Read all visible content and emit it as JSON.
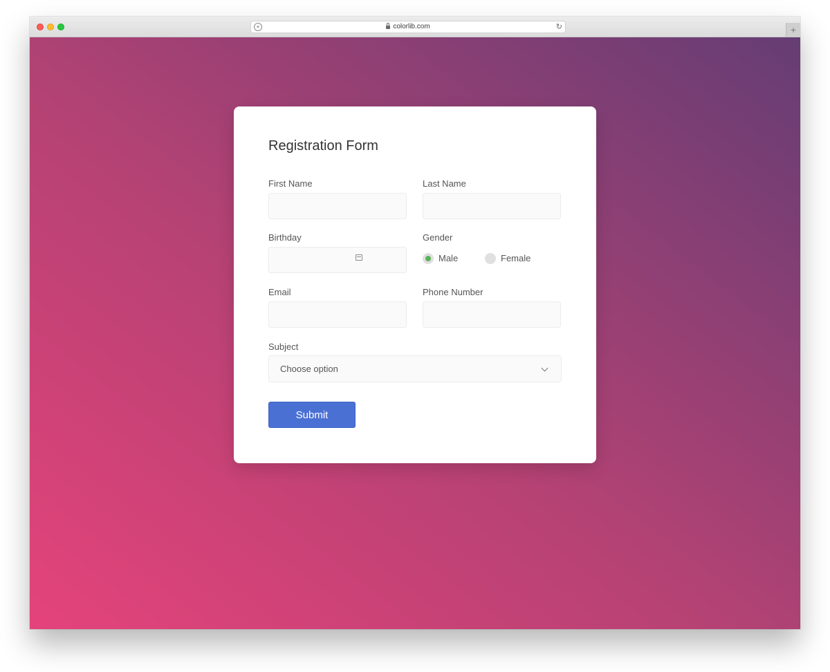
{
  "browser": {
    "url": "colorlib.com",
    "icons": {
      "add": "plus-circle-icon",
      "secure": "lock-icon",
      "reload": "reload-icon",
      "new_tab": "plus-icon"
    }
  },
  "form": {
    "title": "Registration Form",
    "first_name": {
      "label": "First Name",
      "value": "",
      "placeholder": ""
    },
    "last_name": {
      "label": "Last Name",
      "value": "",
      "placeholder": ""
    },
    "birthday": {
      "label": "Birthday",
      "value": "",
      "icon": "calendar-icon"
    },
    "gender": {
      "label": "Gender",
      "options": [
        {
          "label": "Male",
          "checked": true
        },
        {
          "label": "Female",
          "checked": false
        }
      ]
    },
    "email": {
      "label": "Email",
      "value": "",
      "placeholder": ""
    },
    "phone": {
      "label": "Phone Number",
      "value": "",
      "placeholder": ""
    },
    "subject": {
      "label": "Subject",
      "selected": "Choose option",
      "icon": "chevron-down-icon"
    },
    "submit_label": "Submit"
  },
  "colors": {
    "gradient_start": "#e4437a",
    "gradient_end": "#653d74",
    "button": "#4a70d4",
    "radio_checked": "#5bb35b"
  }
}
